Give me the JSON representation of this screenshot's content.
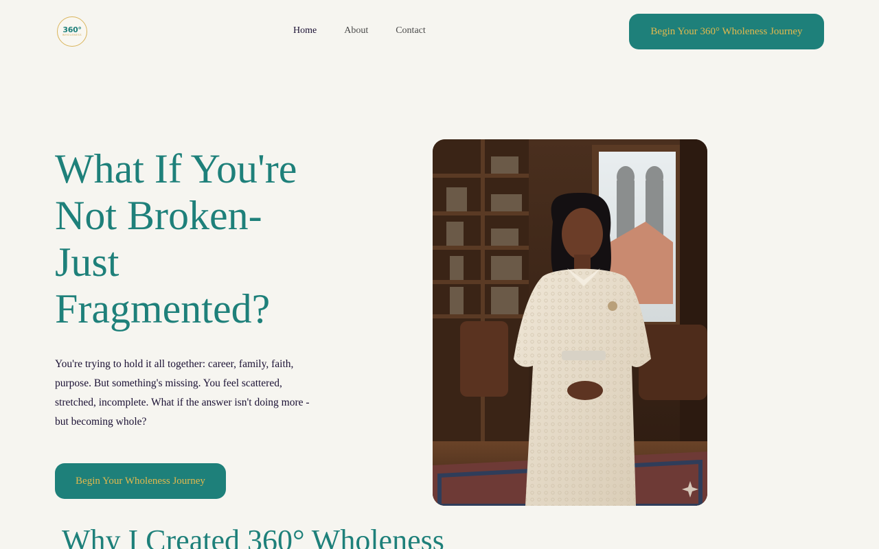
{
  "logo": {
    "number": "360°",
    "word": "WHOLENESS"
  },
  "nav": {
    "items": [
      {
        "label": "Home",
        "active": true
      },
      {
        "label": "About",
        "active": false
      },
      {
        "label": "Contact",
        "active": false
      }
    ]
  },
  "header": {
    "cta_label": "Begin Your 360° Wholeness Journey"
  },
  "hero": {
    "title_lines": [
      "What If You're",
      "Not Broken-",
      "Just",
      "Fragmented?"
    ],
    "text": "You're trying to hold it all together: career, family, faith, purpose. But something's missing. You feel scattered, stretched, incomplete. What if the answer isn't doing more - but becoming whole?",
    "cta_label": "Begin Your Wholeness Journey"
  },
  "section": {
    "title": "Why I Created 360° Wholeness"
  },
  "colors": {
    "background": "#f6f5f0",
    "teal": "#1e807a",
    "gold": "#e2b94e",
    "ink": "#1a1033"
  },
  "icons": {
    "portrait_corner": "sparkle-icon"
  }
}
